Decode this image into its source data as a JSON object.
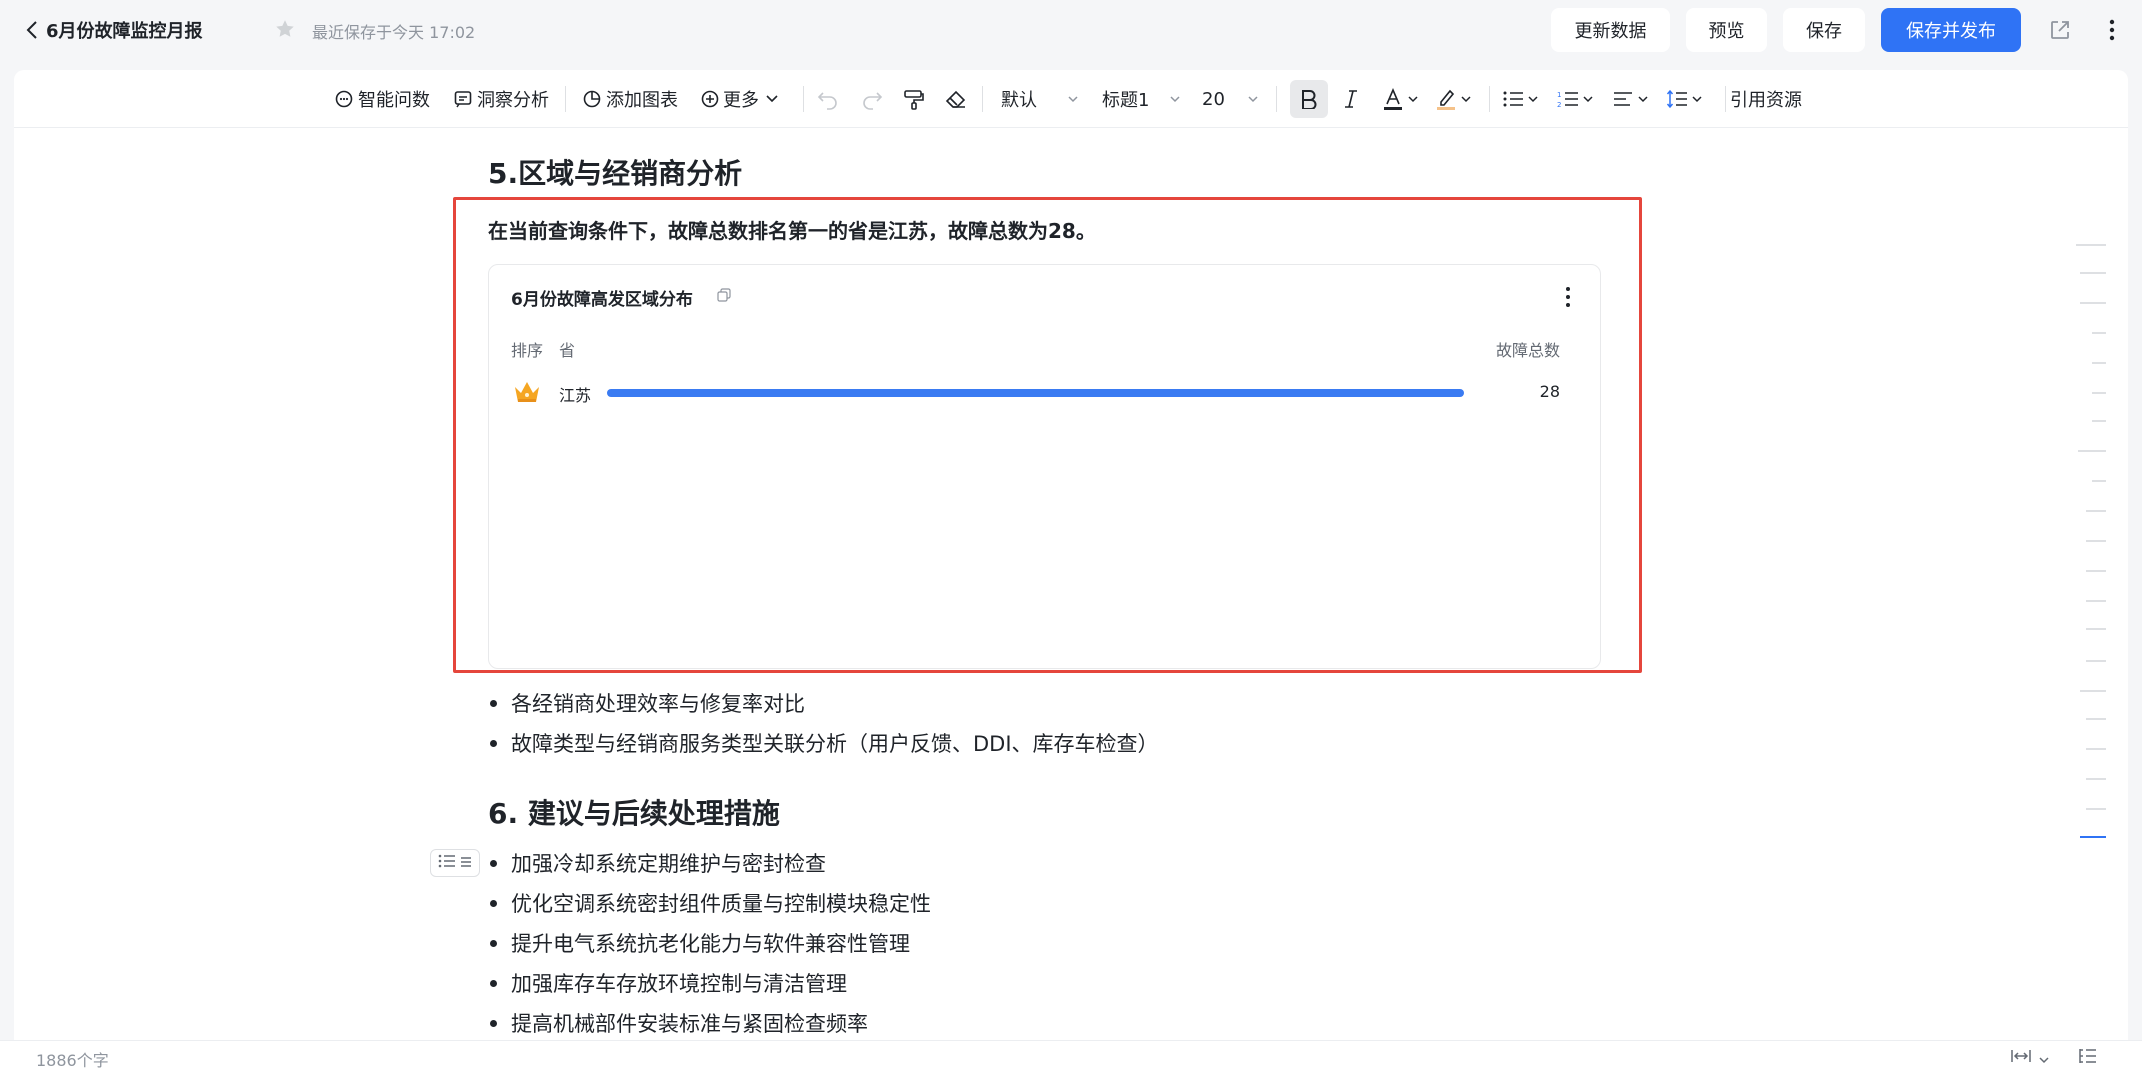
{
  "header": {
    "title": "6月份故障监控月报",
    "saved_text": "最近保存于今天 17:02",
    "buttons": {
      "refresh": "更新数据",
      "preview": "预览",
      "save": "保存",
      "publish": "保存并发布"
    }
  },
  "toolbar": {
    "smart_ask": "智能问数",
    "insight": "洞察分析",
    "add_chart": "添加图表",
    "more": "更多",
    "font": "默认",
    "heading": "标题1",
    "font_size": "20",
    "cite": "引用资源"
  },
  "section5": {
    "heading": "5.区域与经销商分析",
    "summary": "在当前查询条件下，故障总数排名第一的省是江苏，故障总数为28。",
    "card": {
      "title": "6月份故障高发区域分布",
      "col_rank": "排序",
      "col_province": "省",
      "col_total": "故障总数",
      "rows": [
        {
          "province": "江苏",
          "total": "28",
          "fill": 1.0
        }
      ]
    },
    "bullets": [
      "各经销商处理效率与修复率对比",
      "故障类型与经销商服务类型关联分析（用户反馈、DDI、库存车检查）"
    ]
  },
  "section6": {
    "heading": "6. 建议与后续处理措施",
    "bullets": [
      "加强冷却系统定期维护与密封检查",
      "优化空调系统密封组件质量与控制模块稳定性",
      "提升电气系统抗老化能力与软件兼容性管理",
      "加强库存车存放环境控制与清洁管理",
      "提高机械部件安装标准与紧固检查频率"
    ]
  },
  "footer": {
    "word_count": "1886个字"
  },
  "colors": {
    "accent": "#2f73f5",
    "selection": "#e5463c",
    "bar": "#3a7bf2",
    "crown": "#f5a623"
  }
}
